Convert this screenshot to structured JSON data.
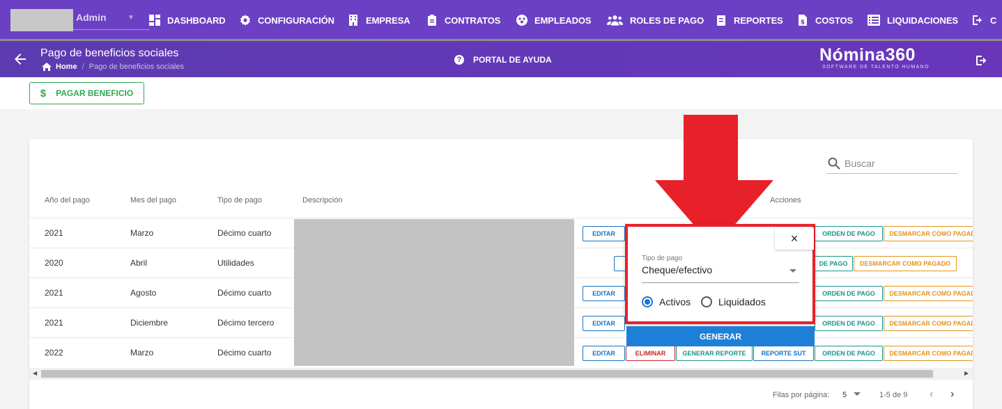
{
  "topnav": {
    "user": "Admin",
    "items": [
      {
        "label": "DASHBOARD",
        "icon": "dashboard-icon"
      },
      {
        "label": "CONFIGURACIÓN",
        "icon": "gear-icon"
      },
      {
        "label": "EMPRESA",
        "icon": "building-icon"
      },
      {
        "label": "CONTRATOS",
        "icon": "clipboard-icon"
      },
      {
        "label": "EMPLEADOS",
        "icon": "employees-icon"
      },
      {
        "label": "ROLES DE PAGO",
        "icon": "users-icon"
      },
      {
        "label": "REPORTES",
        "icon": "report-icon"
      },
      {
        "label": "COSTOS",
        "icon": "dollar-file-icon"
      },
      {
        "label": "LIQUIDACIONES",
        "icon": "list-icon"
      },
      {
        "label": "C",
        "icon": "logout-icon"
      }
    ]
  },
  "header": {
    "title": "Pago de beneficios sociales",
    "breadcrumb_home": "Home",
    "breadcrumb_sep": "/",
    "breadcrumb_current": "Pago de beneficios sociales",
    "help_label": "PORTAL DE AYUDA",
    "brand": "Nómina360",
    "brand_sub": "SOFTWARE DE TALENTO HUMANO"
  },
  "actions": {
    "pay_label": "PAGAR BENEFICIO",
    "pay_icon": "$"
  },
  "table": {
    "search_placeholder": "Buscar",
    "headers": {
      "year": "Año del pago",
      "month": "Mes del pago",
      "type": "Tipo de pago",
      "description": "Descripción",
      "actions": "Acciones"
    },
    "rows": [
      {
        "year": "2021",
        "month": "Marzo",
        "type": "Décimo cuarto"
      },
      {
        "year": "2020",
        "month": "Abril",
        "type": "Utilidades"
      },
      {
        "year": "2021",
        "month": "Agosto",
        "type": "Décimo cuarto"
      },
      {
        "year": "2021",
        "month": "Diciembre",
        "type": "Décimo tercero"
      },
      {
        "year": "2022",
        "month": "Marzo",
        "type": "Décimo cuarto"
      }
    ],
    "buttons": {
      "edit": "EDITAR",
      "delete": "ELIMINAR",
      "generate_report": "GENERAR REPORTE",
      "sut_report": "REPORTE SUT",
      "payment_order": "ORDEN DE PAGO",
      "payment_order_partial": "DE PAGO",
      "unmark": "DESMARCAR COMO PAGADO",
      "unmark_cut": "DESMARCAR COMO PAGAD"
    },
    "footer": {
      "rows_per_page_label": "Filas por página:",
      "rows_per_page": "5",
      "range": "1-5 de 9"
    }
  },
  "popup": {
    "close": "×",
    "select_label": "Tipo de pago",
    "select_value": "Cheque/efectivo",
    "radio_active": "Activos",
    "radio_liquidated": "Liquidados",
    "selected": "Activos",
    "generate": "GENERAR"
  },
  "colors": {
    "nav": "#6b40c4",
    "accent_arrow": "#e8202a",
    "green": "#2fa84f",
    "blue": "#1e7fd8"
  }
}
